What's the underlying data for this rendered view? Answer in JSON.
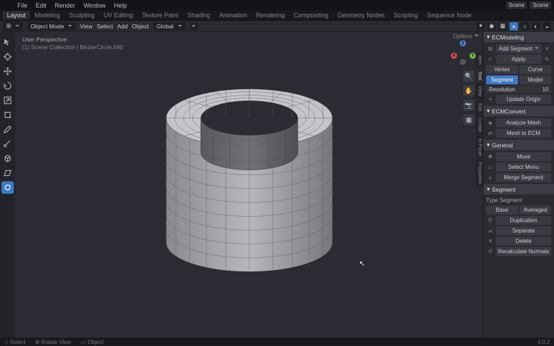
{
  "topmenu": [
    "File",
    "Edit",
    "Render",
    "Window",
    "Help"
  ],
  "workspaces": {
    "items": [
      "Layout",
      "Modeling",
      "Sculpting",
      "UV Editing",
      "Texture Paint",
      "Shading",
      "Animation",
      "Rendering",
      "Compositing",
      "Geometry Nodes",
      "Scripting",
      "Sequence Node"
    ],
    "active": 0
  },
  "scene": {
    "name": "Scene",
    "layer": "Scene"
  },
  "header": {
    "mode": "Object Mode",
    "menus": [
      "View",
      "Select",
      "Add",
      "Object"
    ],
    "orient": "Global",
    "right_opts": "Options"
  },
  "vp": {
    "line1": "User Perspective",
    "line2": "(1) Scene Collection | BézierCircle.040"
  },
  "gizmo": {
    "x": "X",
    "y": "Y",
    "z": "Z"
  },
  "toolbar": [
    "cursor",
    "select",
    "move",
    "rotate",
    "scale",
    "transform",
    "annotate",
    "measure",
    "addcube",
    "shear",
    "xray"
  ],
  "sidepanels": [
    "Item",
    "Tool",
    "View",
    "Edit",
    "Create",
    "N-Panel",
    "Proportion"
  ],
  "panel": {
    "title": "ECModeling",
    "addseg": "Add Segment",
    "apply": "Apply",
    "vertex": "Vertex",
    "curve": "Curve",
    "segment": "Segment",
    "model": "Model",
    "res_label": "Resolution",
    "res_val": "10",
    "update": "Update Origin",
    "convert_title": "ECMConvert",
    "analyze": "Analyze Mesh",
    "mesh2ecm": "Mesh to ECM",
    "general_title": "General",
    "move": "Move",
    "selmenu": "Select Menu",
    "mergeseg": "Merge Segment",
    "segment_title": "Segment",
    "type_label": "Type Segment",
    "base": "Base",
    "averaged": "Averaged",
    "dup": "Duplication",
    "sep": "Separate",
    "del": "Delete",
    "recalc": "Recalculate Normals"
  },
  "status": {
    "left": "Select",
    "mid1": "Rotate View",
    "mid2": "Object",
    "right": "4.0.2"
  }
}
